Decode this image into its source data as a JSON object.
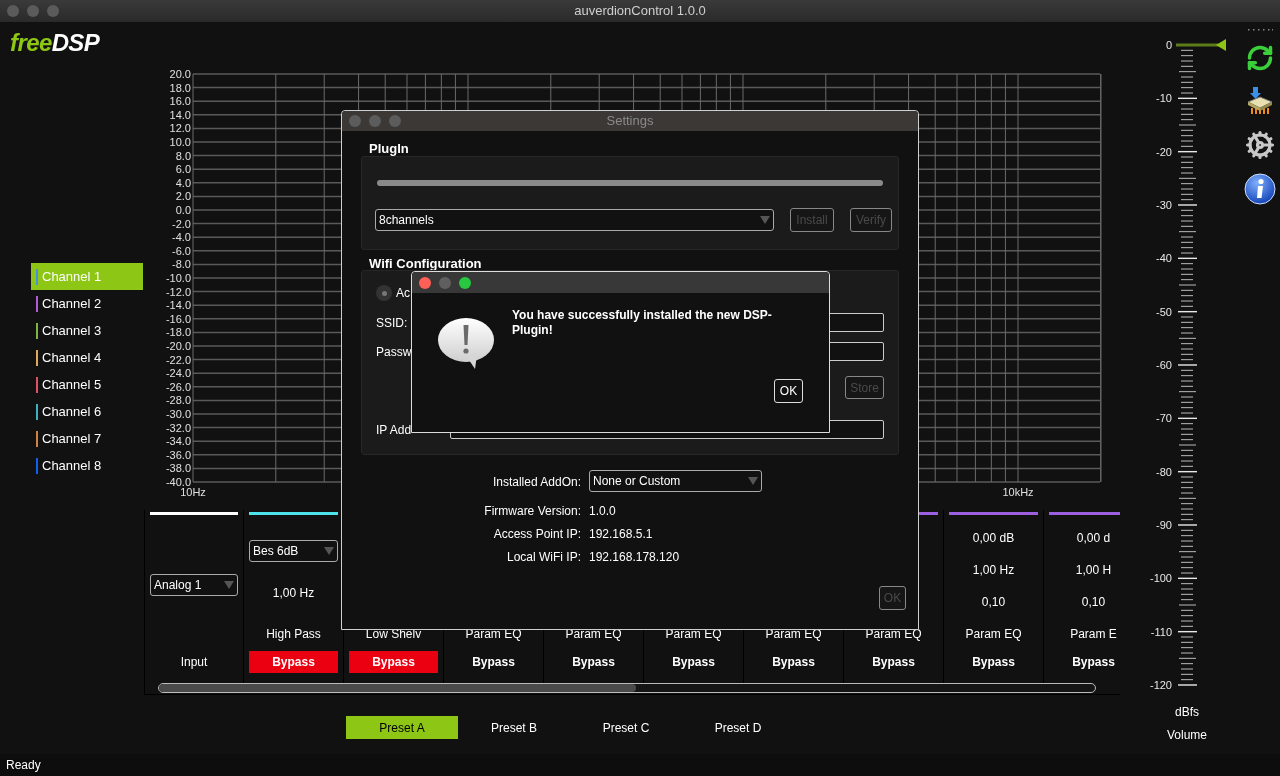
{
  "window": {
    "title": "auverdionControl 1.0.0"
  },
  "logo": {
    "left": "free",
    "right": "DSP"
  },
  "channels": [
    {
      "label": "Channel 1",
      "color": "#4a90e2",
      "selected": true
    },
    {
      "label": "Channel 2",
      "color": "#b05ad8",
      "selected": false
    },
    {
      "label": "Channel 3",
      "color": "#7cb342",
      "selected": false
    },
    {
      "label": "Channel 4",
      "color": "#e0a858",
      "selected": false
    },
    {
      "label": "Channel 5",
      "color": "#e05060",
      "selected": false
    },
    {
      "label": "Channel 6",
      "color": "#40b0c0",
      "selected": false
    },
    {
      "label": "Channel 7",
      "color": "#d08040",
      "selected": false
    },
    {
      "label": "Channel 8",
      "color": "#1060f0",
      "selected": false
    }
  ],
  "response_graph": {
    "x_labels": [
      "10Hz",
      "10kHz"
    ],
    "y_labels": [
      "20.0",
      "18.0",
      "16.0",
      "14.0",
      "12.0",
      "10.0",
      "8.0",
      "6.0",
      "4.0",
      "2.0",
      "0.0",
      "-2.0",
      "-4.0",
      "-6.0",
      "-8.0",
      "-10.0",
      "-12.0",
      "-14.0",
      "-16.0",
      "-18.0",
      "-20.0",
      "-22.0",
      "-24.0",
      "-26.0",
      "-28.0",
      "-30.0",
      "-32.0",
      "-34.0",
      "-36.0",
      "-38.0",
      "-40.0"
    ]
  },
  "strips": [
    {
      "kind": "input",
      "color": "#ffffff",
      "select": "Analog 1",
      "label": "Input"
    },
    {
      "kind": "filter",
      "color": "#4ee3ea",
      "select": "Bes 6dB",
      "freq": "1,00 Hz",
      "type": "High Pass",
      "bypass": {
        "text": "Bypass",
        "active": true
      }
    },
    {
      "kind": "param",
      "type": "Low Shelv",
      "bypass": {
        "text": "Bypass",
        "active": true
      }
    },
    {
      "kind": "param",
      "type": "Param EQ",
      "bypass": {
        "text": "Bypass",
        "active": false
      }
    },
    {
      "kind": "param",
      "type": "Param EQ",
      "bypass": {
        "text": "Bypass",
        "active": false
      }
    },
    {
      "kind": "param",
      "type": "Param EQ",
      "bypass": {
        "text": "Bypass",
        "active": false
      }
    },
    {
      "kind": "param",
      "type": "Param EQ",
      "bypass": {
        "text": "Bypass",
        "active": false
      }
    },
    {
      "kind": "param",
      "color": "#9b5fe0",
      "type": "Param EQ",
      "bypass": {
        "text": "Bypass",
        "active": false
      }
    },
    {
      "kind": "param",
      "color": "#9b5fe0",
      "gain": "0,00 dB",
      "freq": "1,00 Hz",
      "q": "0,10",
      "type": "Param EQ",
      "bypass": {
        "text": "Bypass",
        "active": false
      }
    },
    {
      "kind": "param",
      "color": "#9b5fe0",
      "gain": "0,00 d",
      "freq": "1,00 H",
      "q": "0,10",
      "type": "Param E",
      "bypass": {
        "text": "Bypass",
        "active": false
      }
    }
  ],
  "presets": [
    {
      "label": "Preset A",
      "selected": true
    },
    {
      "label": "Preset B",
      "selected": false
    },
    {
      "label": "Preset C",
      "selected": false
    },
    {
      "label": "Preset D",
      "selected": false
    }
  ],
  "volume": {
    "level": 1,
    "ticks": [
      "0",
      "-10",
      "-20",
      "-30",
      "-40",
      "-50",
      "-60",
      "-70",
      "-80",
      "-90",
      "-100",
      "-110",
      "-120"
    ],
    "unit": "dBfs",
    "label": "Volume"
  },
  "status_bar": "Ready",
  "settings": {
    "title": "Settings",
    "plugin": {
      "title": "PlugIn",
      "level": 1,
      "select": "8channels",
      "buttons": [
        {
          "label": "Install",
          "disabled": true
        },
        {
          "label": "Verify",
          "disabled": true
        }
      ]
    },
    "wifi": {
      "title": "Wifi Configuration",
      "radio": {
        "label": "Ac",
        "selected": true
      },
      "ssid_label": "SSID:",
      "password_label": "Passw",
      "store": {
        "label": "Store",
        "disabled": true
      },
      "ip_label": "IP Add"
    },
    "info": [
      {
        "kind": "select",
        "label": "Installed AddOn:",
        "value": "None or Custom"
      },
      {
        "kind": "text",
        "label": "Firmware Version:",
        "value": "1.0.0"
      },
      {
        "kind": "text",
        "label": "Access Point IP:",
        "value": "192.168.5.1"
      },
      {
        "kind": "text",
        "label": "Local WiFi IP:",
        "value": "192.168.178.120"
      }
    ],
    "ok": {
      "label": "OK",
      "disabled": true
    }
  },
  "message": {
    "text": "You have successfully installed the new DSP-Plugin!",
    "ok": "OK"
  }
}
